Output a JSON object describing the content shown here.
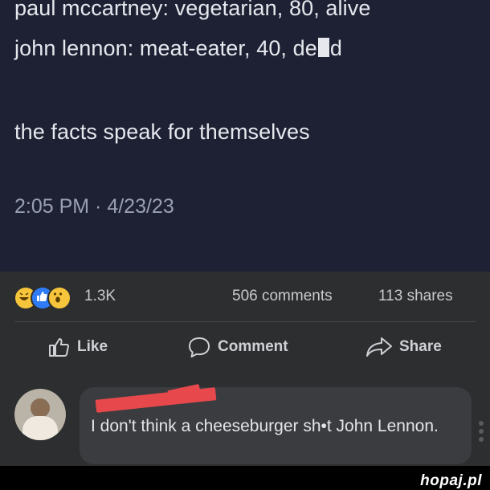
{
  "tweet": {
    "line1": "paul mccartney: vegetarian, 80, alive",
    "line2_before": "john lennon: meat-eater, 40, de",
    "line2_after": "d",
    "line3": "the facts speak for themselves",
    "timestamp": "2:05 PM · 4/23/23"
  },
  "reactions": {
    "icons": [
      "haha-emoji-icon",
      "like-emoji-icon",
      "wow-emoji-icon"
    ],
    "count": "1.3K",
    "comments": "506 comments",
    "shares": "113 shares"
  },
  "actions": {
    "like_label": "Like",
    "comment_label": "Comment",
    "share_label": "Share"
  },
  "comment": {
    "text": "I don't think a cheeseburger sh•t John Lennon."
  },
  "watermark": "hopaj.pl",
  "colors": {
    "tweet_bg": "#1d2133",
    "fb_bg": "#2d2e30",
    "bubble_bg": "#3b3c3f",
    "redaction_red": "#e6484c"
  }
}
